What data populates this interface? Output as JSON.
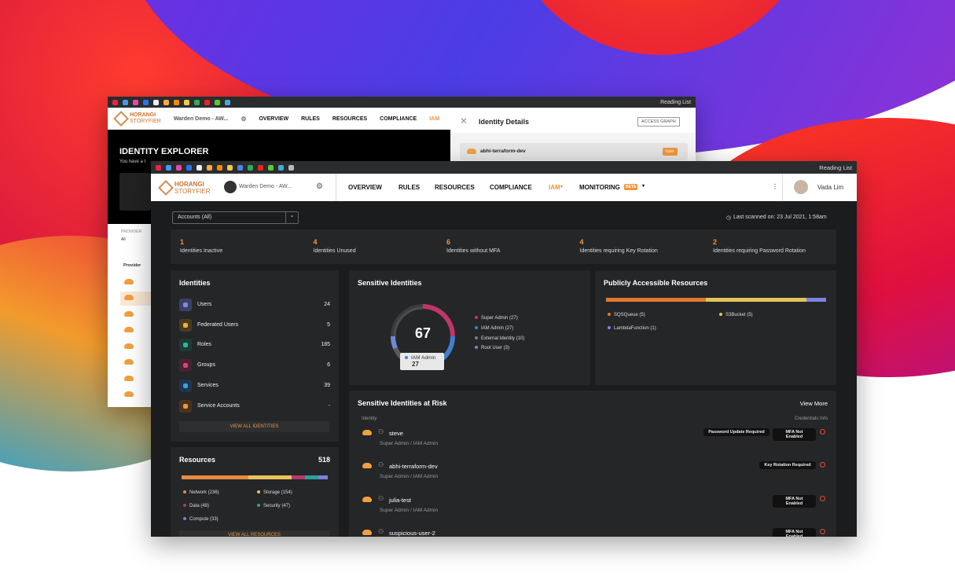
{
  "colors": {
    "accent": "#f0963c",
    "panel": "#252628",
    "bg": "#1b1c1e"
  },
  "back_window": {
    "reading_list": "Reading List",
    "logo_line1": "HORANGI",
    "logo_line2": "STORYFIER",
    "account": "Warden Demo - AW...",
    "nav": [
      "OVERVIEW",
      "RULES",
      "RESOURCES",
      "COMPLIANCE",
      "IAM"
    ],
    "page_title": "IDENTITY EXPLORER",
    "subtitle": "You have a t",
    "provider_label": "PROVIDER",
    "provider_value": "All",
    "provider_col": "Provider",
    "drawer_title": "Identity Details",
    "access_graph": "ACCESS GRAPH",
    "drawer_item": "abhi-terraform-dev",
    "drawer_badge": "User"
  },
  "front_window": {
    "reading_list": "Reading List",
    "logo_line1": "HORANGI",
    "logo_line2": "STORYFIER",
    "account": "Warden Demo - AW...",
    "nav": {
      "overview": "OVERVIEW",
      "rules": "RULES",
      "resources": "RESOURCES",
      "compliance": "COMPLIANCE",
      "iam": "IAM",
      "monitoring": "MONITORING",
      "beta": "BETA"
    },
    "user": "Vada Lim",
    "accounts_select": "Accounts (All)",
    "last_scanned": "Last scanned on: 23 Jul 2021, 1:58am",
    "stats": [
      {
        "value": "1",
        "label": "Identities Inactive"
      },
      {
        "value": "4",
        "label": "Identities Unused"
      },
      {
        "value": "6",
        "label": "Identities without MFA"
      },
      {
        "value": "4",
        "label": "Identities requiring Key Rotation"
      },
      {
        "value": "2",
        "label": "Identities requiring Password Rotation"
      }
    ],
    "identities": {
      "title": "Identities",
      "items": [
        {
          "label": "Users",
          "count": "24"
        },
        {
          "label": "Federated Users",
          "count": "5"
        },
        {
          "label": "Roles",
          "count": "185"
        },
        {
          "label": "Groups",
          "count": "6"
        },
        {
          "label": "Services",
          "count": "39"
        },
        {
          "label": "Service Accounts",
          "count": "-"
        }
      ],
      "view_all": "VIEW ALL IDENTITIES"
    },
    "sensitive": {
      "title": "Sensitive Identities",
      "total": "67",
      "tooltip_label": "IAM Admin",
      "tooltip_value": "27",
      "legend": [
        "Super Admin (27)",
        "IAM Admin (27)",
        "External Identity (10)",
        "Root User (3)"
      ]
    },
    "public": {
      "title": "Publicly Accessible Resources",
      "legend": [
        "SQSQueue (5)",
        "S3Bucket (5)",
        "LambdaFunction (1)"
      ]
    },
    "resources": {
      "title": "Resources",
      "total": "518",
      "legend": [
        "Network (236)",
        "Storage (154)",
        "Data (48)",
        "Security (47)",
        "Compute (33)"
      ],
      "view_all": "VIEW ALL RESOURCES"
    },
    "risk": {
      "title": "Sensitive Identities at Risk",
      "view_more": "View More",
      "col_identity": "Identity",
      "col_creds": "Credentials Info",
      "rows": [
        {
          "name": "steve",
          "role": "Super Admin  /  IAM Admin",
          "tags": [
            "Password Update Required",
            "MFA Not Enabled"
          ]
        },
        {
          "name": "abhi-terraform-dev",
          "role": "Super Admin  /  IAM Admin",
          "tags": [
            "Key Rotation Required"
          ]
        },
        {
          "name": "julia-test",
          "role": "Super Admin  /  IAM Admin",
          "tags": [
            "MFA Not Enabled"
          ]
        },
        {
          "name": "suspicious-user-2",
          "role": "",
          "tags": [
            "MFA Not Enabled"
          ]
        }
      ]
    }
  }
}
